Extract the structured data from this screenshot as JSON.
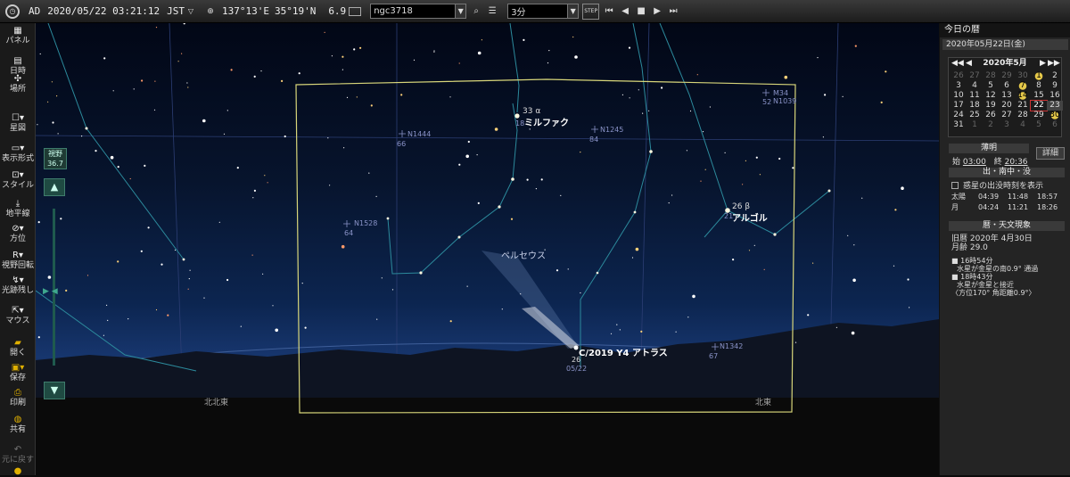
{
  "topbar": {
    "era": "AD",
    "datetime": "2020/05/22 03:21:12",
    "timezone": "JST",
    "longitude": "137°13'E",
    "latitude": "35°19'N",
    "magnitude": "6.9",
    "search_value": "ngc3718",
    "interval_value": "3分",
    "step_label": "STEP"
  },
  "leftbar": {
    "items": [
      {
        "label": "パネル"
      },
      {
        "label": "日時"
      },
      {
        "label": "場所"
      },
      {
        "label": "星図"
      },
      {
        "label": "表示形式"
      },
      {
        "label": "スタイル"
      },
      {
        "label": "地平線"
      },
      {
        "label": "方位"
      },
      {
        "label": "視野回転"
      },
      {
        "label": "光跡残し"
      },
      {
        "label": "マウス"
      },
      {
        "label": "開く"
      },
      {
        "label": "保存"
      },
      {
        "label": "印刷"
      },
      {
        "label": "共有"
      },
      {
        "label": "元に戻す"
      }
    ],
    "fov_label": "視野",
    "fov_value": "36.7"
  },
  "sky": {
    "labels": {
      "mirfak_id": "33 α",
      "mirfak_name": "ミルファク",
      "mirfak_num": "18",
      "algol_id": "26 β",
      "algol_name": "アルゴル",
      "algol_num": "21",
      "perseus": "ペルセウス",
      "comet_name": "C/2019 Y4 アトラス",
      "comet_num": "26",
      "comet_date": "05/22",
      "n1444": "N1444",
      "n1444_n": "66",
      "n1245": "N1245",
      "n1245_n": "84",
      "n1528": "N1528",
      "n1528_n": "64",
      "n1342": "N1342",
      "n1342_n": "67",
      "m34": "M34",
      "n1039": "N1039",
      "m34_n": "52",
      "dir_nne": "北北東",
      "dir_ne": "北東"
    }
  },
  "rpanel": {
    "title": "今日の暦",
    "date": "2020年05月22日(金)",
    "month": "2020年5月",
    "calendar": [
      {
        "d": "26",
        "c": "dim"
      },
      {
        "d": "27",
        "c": "dim"
      },
      {
        "d": "28",
        "c": "dim"
      },
      {
        "d": "29",
        "c": "dim"
      },
      {
        "d": "30",
        "c": "dim"
      },
      {
        "d": "1",
        "c": "moon"
      },
      {
        "d": "2",
        "c": ""
      },
      {
        "d": "3",
        "c": ""
      },
      {
        "d": "4",
        "c": ""
      },
      {
        "d": "5",
        "c": ""
      },
      {
        "d": "6",
        "c": ""
      },
      {
        "d": "7",
        "c": "moon"
      },
      {
        "d": "8",
        "c": ""
      },
      {
        "d": "9",
        "c": ""
      },
      {
        "d": "10",
        "c": ""
      },
      {
        "d": "11",
        "c": ""
      },
      {
        "d": "12",
        "c": ""
      },
      {
        "d": "13",
        "c": ""
      },
      {
        "d": "14",
        "c": "moon"
      },
      {
        "d": "15",
        "c": ""
      },
      {
        "d": "16",
        "c": ""
      },
      {
        "d": "17",
        "c": ""
      },
      {
        "d": "18",
        "c": ""
      },
      {
        "d": "19",
        "c": ""
      },
      {
        "d": "20",
        "c": ""
      },
      {
        "d": "21",
        "c": ""
      },
      {
        "d": "22",
        "c": "today"
      },
      {
        "d": "23",
        "c": "sel"
      },
      {
        "d": "24",
        "c": ""
      },
      {
        "d": "25",
        "c": ""
      },
      {
        "d": "26",
        "c": ""
      },
      {
        "d": "27",
        "c": ""
      },
      {
        "d": "28",
        "c": ""
      },
      {
        "d": "29",
        "c": ""
      },
      {
        "d": "30",
        "c": "moon"
      },
      {
        "d": "31",
        "c": ""
      },
      {
        "d": "1",
        "c": "dim"
      },
      {
        "d": "2",
        "c": "dim"
      },
      {
        "d": "3",
        "c": "dim"
      },
      {
        "d": "4",
        "c": "dim"
      },
      {
        "d": "5",
        "c": "dim"
      },
      {
        "d": "6",
        "c": "dim"
      }
    ],
    "twilight_header": "薄明",
    "twilight_start_label": "始",
    "twilight_start": "03:00",
    "twilight_end_label": "終",
    "twilight_end": "20:36",
    "detail_button": "詳細",
    "rise_header": "出・南中・没",
    "planet_checkbox": "惑星の出没時刻を表示",
    "sun_label": "太陽",
    "sun_rise": "04:39",
    "sun_transit": "11:48",
    "sun_set": "18:57",
    "moon_label": "月",
    "moon_rise": "04:24",
    "moon_transit": "11:21",
    "moon_set": "18:26",
    "events_header": "暦・天文現象",
    "lunar_date": "旧暦 2020年 4月30日",
    "moon_age": "月齢 29.0",
    "event1_time": "■ 16時54分",
    "event1_text": "水星が金星の南0.9° 通過",
    "event2_time": "■ 18時43分",
    "event2_text": "水星が金星と接近",
    "event2_detail": "〈方位170° 角距離0.9°〉"
  }
}
